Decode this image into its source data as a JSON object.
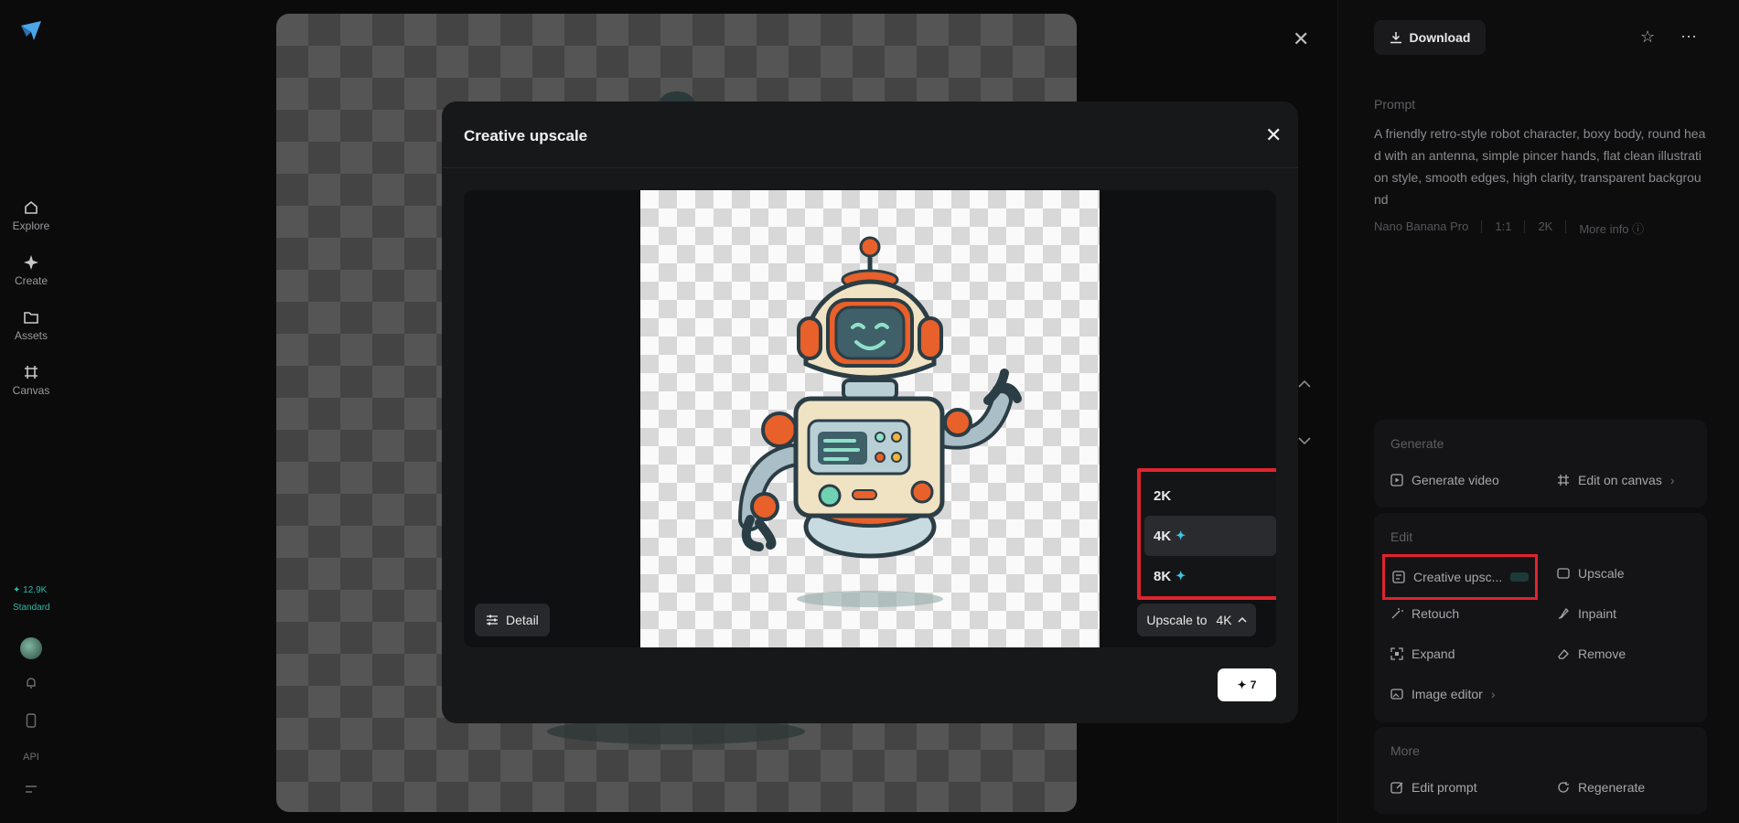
{
  "rail": {
    "items": [
      {
        "label": "Explore",
        "icon": "home-icon"
      },
      {
        "label": "Create",
        "icon": "sparkle-icon"
      },
      {
        "label": "Assets",
        "icon": "folder-icon"
      },
      {
        "label": "Canvas",
        "icon": "canvas-icon"
      }
    ],
    "credits": "12.9K",
    "plan": "Standard",
    "api_label": "API"
  },
  "right_panel": {
    "download_label": "Download",
    "prompt_label": "Prompt",
    "prompt_text": "A friendly retro-style robot character, boxy body, round head with an antenna, simple pincer hands, flat clean illustration style, smooth edges, high clarity, transparent background",
    "meta": {
      "model": "Nano Banana Pro",
      "ratio": "1:1",
      "resolution": "2K",
      "more_info": "More info"
    },
    "generate": {
      "title": "Generate",
      "generate_video": "Generate video",
      "edit_on_canvas": "Edit on canvas"
    },
    "edit": {
      "title": "Edit",
      "creative_upscale": "Creative upsc...",
      "upscale": "Upscale",
      "retouch": "Retouch",
      "inpaint": "Inpaint",
      "expand": "Expand",
      "remove": "Remove",
      "image_editor": "Image editor"
    },
    "more": {
      "title": "More",
      "edit_prompt": "Edit prompt",
      "regenerate": "Regenerate"
    }
  },
  "modal": {
    "title": "Creative upscale",
    "detail_label": "Detail",
    "upscale_prefix": "Upscale to",
    "upscale_value": "4K",
    "options": [
      "2K",
      "4K",
      "8K"
    ],
    "selected_option": "4K",
    "cost": "7"
  }
}
